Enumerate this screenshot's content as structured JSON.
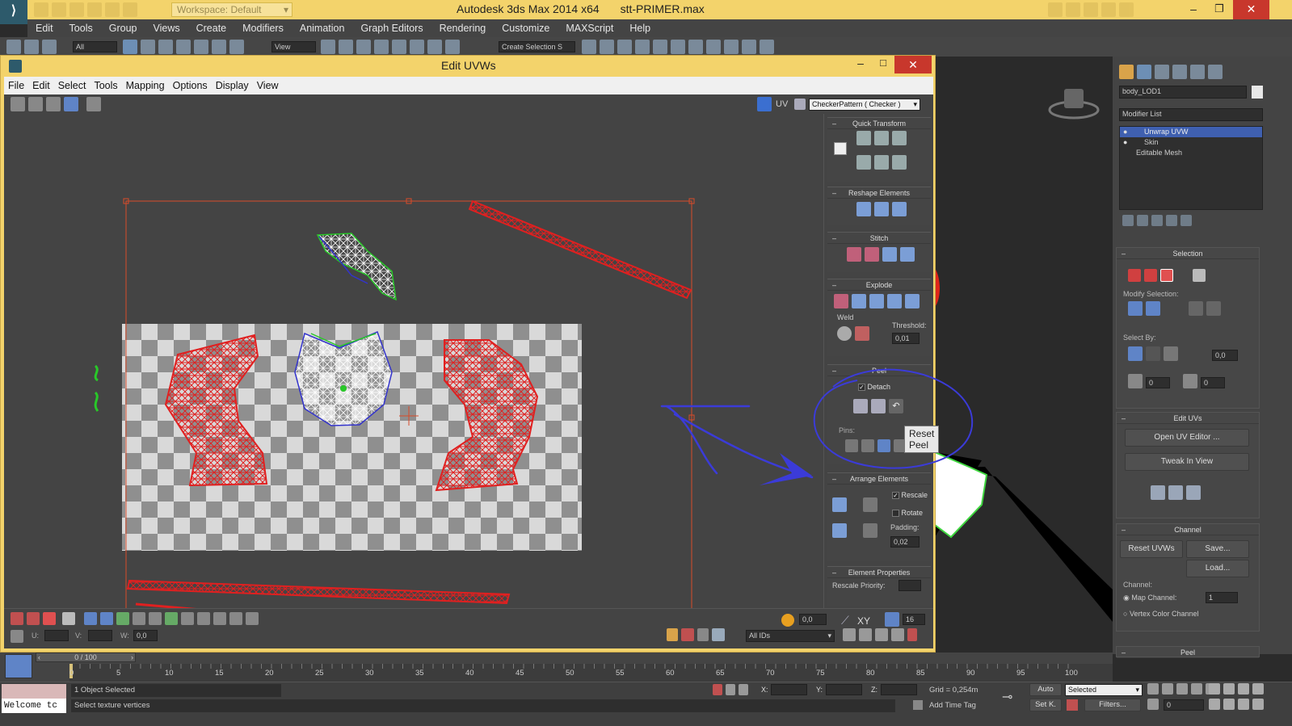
{
  "title_bar": {
    "workspace": "Workspace: Default",
    "title": "Autodesk 3ds Max  2014 x64",
    "file": "stt-PRIMER.max"
  },
  "main_menu": [
    "Edit",
    "Tools",
    "Group",
    "Views",
    "Create",
    "Modifiers",
    "Animation",
    "Graph Editors",
    "Rendering",
    "Customize",
    "MAXScript",
    "Help"
  ],
  "main_toolbar": {
    "filter": "All",
    "ref_coord": "View",
    "selection_set": "Create Selection S"
  },
  "uv_window": {
    "title": "Edit UVWs",
    "menu": [
      "File",
      "Edit",
      "Select",
      "Tools",
      "Mapping",
      "Options",
      "Display",
      "View"
    ],
    "uv_label": "UV",
    "texture_dropdown": "CheckerPattern  ( Checker )",
    "quick_transform": "Quick Transform",
    "reshape_elements": "Reshape Elements",
    "stitch": "Stitch",
    "explode": "Explode",
    "weld": "Weld",
    "threshold_label": "Threshold:",
    "threshold_value": "0,01",
    "peel": "Peel",
    "detach": "Detach",
    "tooltip": "Reset Peel",
    "pins": "Pins:",
    "arrange_elements": "Arrange Elements",
    "rescale": "Rescale",
    "rotate": "Rotate",
    "padding_label": "Padding:",
    "padding_value": "0,02",
    "element_properties": "Element Properties",
    "rescale_priority": "Rescale Priority:",
    "bottom": {
      "spin1": "0,0",
      "xy": "XY",
      "grid": "16",
      "u_label": "U:",
      "v_label": "V:",
      "w_label": "W:",
      "w_value": "0,0",
      "ids": "All IDs"
    }
  },
  "command_panel": {
    "object_name": "body_LOD1",
    "modifier_list": "Modifier List",
    "stack": [
      "Unwrap UVW",
      "Skin",
      "Editable Mesh"
    ],
    "selection": "Selection",
    "modify_selection": "Modify Selection:",
    "select_by": "Select By:",
    "sb_val1": "0,0",
    "sb_val2": "0",
    "sb_val3": "0",
    "edit_uvs": "Edit UVs",
    "open_uv_editor": "Open UV Editor ...",
    "tweak_in_view": "Tweak In View",
    "channel": "Channel",
    "reset_uvws": "Reset UVWs",
    "save": "Save...",
    "load": "Load...",
    "channel_label": "Channel:",
    "map_channel": "Map Channel:",
    "map_channel_value": "1",
    "vertex_color_channel": "Vertex Color Channel",
    "peel": "Peel"
  },
  "timeline": {
    "frame": "0 / 100",
    "ticks": [
      "0",
      "5",
      "10",
      "15",
      "20",
      "25",
      "30",
      "35",
      "40",
      "45",
      "50",
      "55",
      "60",
      "65",
      "70",
      "75",
      "80",
      "85",
      "90",
      "95",
      "100"
    ]
  },
  "status": {
    "welcome": "Welcome tc",
    "selected": "1 Object Selected",
    "prompt": "Select texture vertices",
    "x_label": "X:",
    "y_label": "Y:",
    "z_label": "Z:",
    "grid": "Grid = 0,254m",
    "add_time_tag": "Add Time Tag",
    "auto": "Auto",
    "set_k": "Set K.",
    "selected_dropdown": "Selected",
    "filters": "Filters...",
    "frame_field": "0"
  },
  "colors": {
    "uv_red": "#e02020",
    "annotation_blue": "#3b3bd8",
    "title_yellow": "#f3d36b"
  }
}
